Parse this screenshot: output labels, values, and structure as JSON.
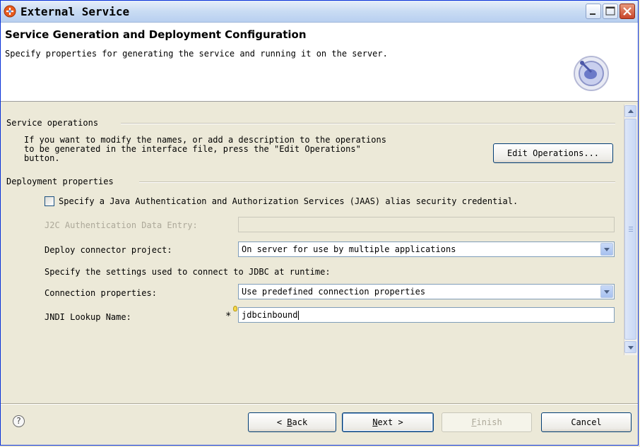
{
  "window": {
    "title": "External Service"
  },
  "header": {
    "title": "Service Generation and Deployment Configuration",
    "description": "Specify properties for generating the service and running it on the server."
  },
  "service_operations": {
    "label": "Service operations",
    "text": "If you want to modify the names, or add a description to the operations\nto be generated in the interface file, press the \"Edit Operations\"\nbutton.",
    "button": "Edit Operations..."
  },
  "deployment": {
    "label": "Deployment properties",
    "jaas_checkbox": {
      "label": "Specify a Java Authentication and Authorization Services (JAAS) alias security credential.",
      "checked": false
    },
    "j2c_label": "J2C Authentication Data Entry:",
    "j2c_value": "",
    "deploy_label": "Deploy connector project:",
    "deploy_value": "On server for use by multiple applications",
    "jdbc_text": "Specify the settings used to connect to JDBC at runtime:",
    "conn_label": "Connection properties:",
    "conn_value": "Use predefined connection properties",
    "jndi_label": "JNDI Lookup Name:",
    "jndi_required": "*",
    "jndi_value": "jdbcinbound"
  },
  "footer": {
    "help": "?",
    "back": {
      "prefix": "< ",
      "mnemonic": "B",
      "rest": "ack"
    },
    "next": {
      "mnemonic": "N",
      "rest": "ext >"
    },
    "finish": {
      "mnemonic": "F",
      "rest": "inish"
    },
    "cancel": "Cancel"
  },
  "colors": {
    "titlebar": "#c9dcf3",
    "dialog_bg": "#ece9d8",
    "header_bg": "#ffffff",
    "disabled_text": "#aca899"
  }
}
